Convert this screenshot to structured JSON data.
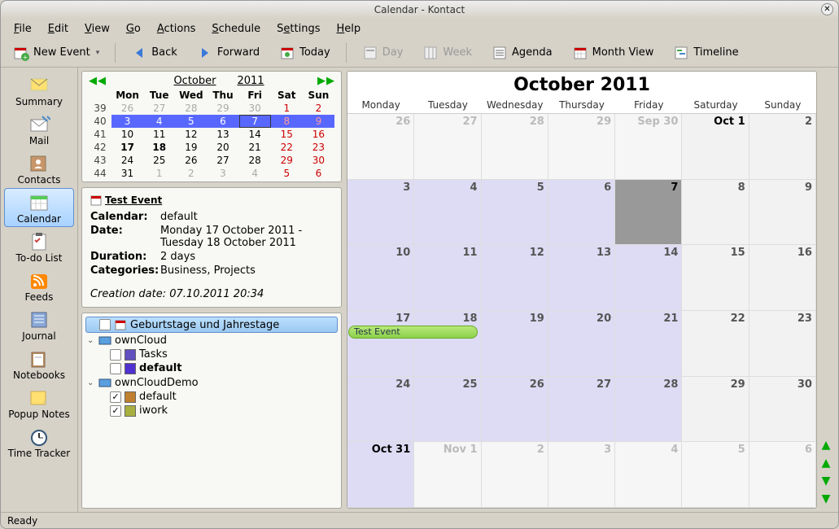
{
  "window": {
    "title": "Calendar - Kontact"
  },
  "menubar": [
    "File",
    "Edit",
    "View",
    "Go",
    "Actions",
    "Schedule",
    "Settings",
    "Help"
  ],
  "toolbar": {
    "new_event": "New Event",
    "back": "Back",
    "forward": "Forward",
    "today": "Today",
    "day": "Day",
    "week": "Week",
    "agenda": "Agenda",
    "month_view": "Month View",
    "timeline": "Timeline"
  },
  "sidebar": [
    {
      "key": "summary",
      "label": "Summary"
    },
    {
      "key": "mail",
      "label": "Mail"
    },
    {
      "key": "contacts",
      "label": "Contacts"
    },
    {
      "key": "calendar",
      "label": "Calendar",
      "active": true
    },
    {
      "key": "todo",
      "label": "To-do List"
    },
    {
      "key": "feeds",
      "label": "Feeds"
    },
    {
      "key": "journal",
      "label": "Journal"
    },
    {
      "key": "notebooks",
      "label": "Notebooks"
    },
    {
      "key": "popup",
      "label": "Popup Notes"
    },
    {
      "key": "timetracker",
      "label": "Time Tracker"
    }
  ],
  "mini_cal": {
    "month": "October",
    "year": "2011",
    "day_headers": [
      "Mon",
      "Tue",
      "Wed",
      "Thu",
      "Fri",
      "Sat",
      "Sun"
    ],
    "weeks": [
      {
        "wk": 39,
        "days": [
          {
            "n": 26,
            "out": true
          },
          {
            "n": 27,
            "out": true
          },
          {
            "n": 28,
            "out": true
          },
          {
            "n": 29,
            "out": true
          },
          {
            "n": 30,
            "out": true
          },
          {
            "n": 1,
            "we": true
          },
          {
            "n": 2,
            "we": true
          }
        ]
      },
      {
        "wk": 40,
        "days": [
          {
            "n": 3,
            "sel": true
          },
          {
            "n": 4,
            "sel": true
          },
          {
            "n": 5,
            "sel": true
          },
          {
            "n": 6,
            "sel": true
          },
          {
            "n": 7,
            "sel": true,
            "today": true
          },
          {
            "n": 8,
            "sel": true,
            "we": true
          },
          {
            "n": 9,
            "sel": true,
            "we": true
          }
        ]
      },
      {
        "wk": 41,
        "days": [
          {
            "n": 10
          },
          {
            "n": 11
          },
          {
            "n": 12
          },
          {
            "n": 13
          },
          {
            "n": 14
          },
          {
            "n": 15,
            "we": true
          },
          {
            "n": 16,
            "we": true
          }
        ]
      },
      {
        "wk": 42,
        "days": [
          {
            "n": 17,
            "bold": true
          },
          {
            "n": 18,
            "bold": true
          },
          {
            "n": 19
          },
          {
            "n": 20
          },
          {
            "n": 21
          },
          {
            "n": 22,
            "we": true
          },
          {
            "n": 23,
            "we": true
          }
        ]
      },
      {
        "wk": 43,
        "days": [
          {
            "n": 24
          },
          {
            "n": 25
          },
          {
            "n": 26
          },
          {
            "n": 27
          },
          {
            "n": 28
          },
          {
            "n": 29,
            "we": true
          },
          {
            "n": 30,
            "we": true
          }
        ]
      },
      {
        "wk": 44,
        "days": [
          {
            "n": 31
          },
          {
            "n": 1,
            "out": true
          },
          {
            "n": 2,
            "out": true
          },
          {
            "n": 3,
            "out": true
          },
          {
            "n": 4,
            "out": true
          },
          {
            "n": 5,
            "out": true,
            "we": true
          },
          {
            "n": 6,
            "out": true,
            "we": true
          }
        ]
      }
    ]
  },
  "event": {
    "title": "Test Event",
    "calendar_label": "Calendar:",
    "calendar": "default",
    "date_label": "Date:",
    "date": "Monday 17 October 2011 - Tuesday 18 October 2011",
    "duration_label": "Duration:",
    "duration": "2 days",
    "categories_label": "Categories:",
    "categories": "Business, Projects",
    "creation": "Creation date: 07.10.2011 20:34"
  },
  "tree": {
    "birthday": "Geburtstage und Jahrestage",
    "owncloud": "ownCloud",
    "tasks": "Tasks",
    "default": "default",
    "ownclouddemo": "ownCloudDemo",
    "demo_default": "default",
    "iwork": "iwork"
  },
  "month_view": {
    "title": "October 2011",
    "day_headers": [
      "Monday",
      "Tuesday",
      "Wednesday",
      "Thursday",
      "Friday",
      "Saturday",
      "Sunday"
    ],
    "cells": [
      [
        {
          "l": "26",
          "out": true
        },
        {
          "l": "27",
          "out": true
        },
        {
          "l": "28",
          "out": true
        },
        {
          "l": "29",
          "out": true
        },
        {
          "l": "Sep 30",
          "out": true,
          "black": false
        },
        {
          "l": "Oct 1",
          "we": true,
          "first": true
        },
        {
          "l": "2",
          "we": true
        }
      ],
      [
        {
          "l": "3"
        },
        {
          "l": "4"
        },
        {
          "l": "5"
        },
        {
          "l": "6"
        },
        {
          "l": "7",
          "today": true
        },
        {
          "l": "8",
          "we": true
        },
        {
          "l": "9",
          "we": true
        }
      ],
      [
        {
          "l": "10"
        },
        {
          "l": "11"
        },
        {
          "l": "12"
        },
        {
          "l": "13"
        },
        {
          "l": "14"
        },
        {
          "l": "15",
          "we": true
        },
        {
          "l": "16",
          "we": true
        }
      ],
      [
        {
          "l": "17",
          "ev": "Test Event"
        },
        {
          "l": "18"
        },
        {
          "l": "19"
        },
        {
          "l": "20"
        },
        {
          "l": "21"
        },
        {
          "l": "22",
          "we": true
        },
        {
          "l": "23",
          "we": true
        }
      ],
      [
        {
          "l": "24"
        },
        {
          "l": "25"
        },
        {
          "l": "26"
        },
        {
          "l": "27"
        },
        {
          "l": "28"
        },
        {
          "l": "29",
          "we": true
        },
        {
          "l": "30",
          "we": true
        }
      ],
      [
        {
          "l": "Oct 31",
          "first": true
        },
        {
          "l": "Nov 1",
          "out": true
        },
        {
          "l": "2",
          "out": true
        },
        {
          "l": "3",
          "out": true
        },
        {
          "l": "4",
          "out": true
        },
        {
          "l": "5",
          "out": true,
          "we": true
        },
        {
          "l": "6",
          "out": true,
          "we": true
        }
      ]
    ]
  },
  "status": "Ready"
}
